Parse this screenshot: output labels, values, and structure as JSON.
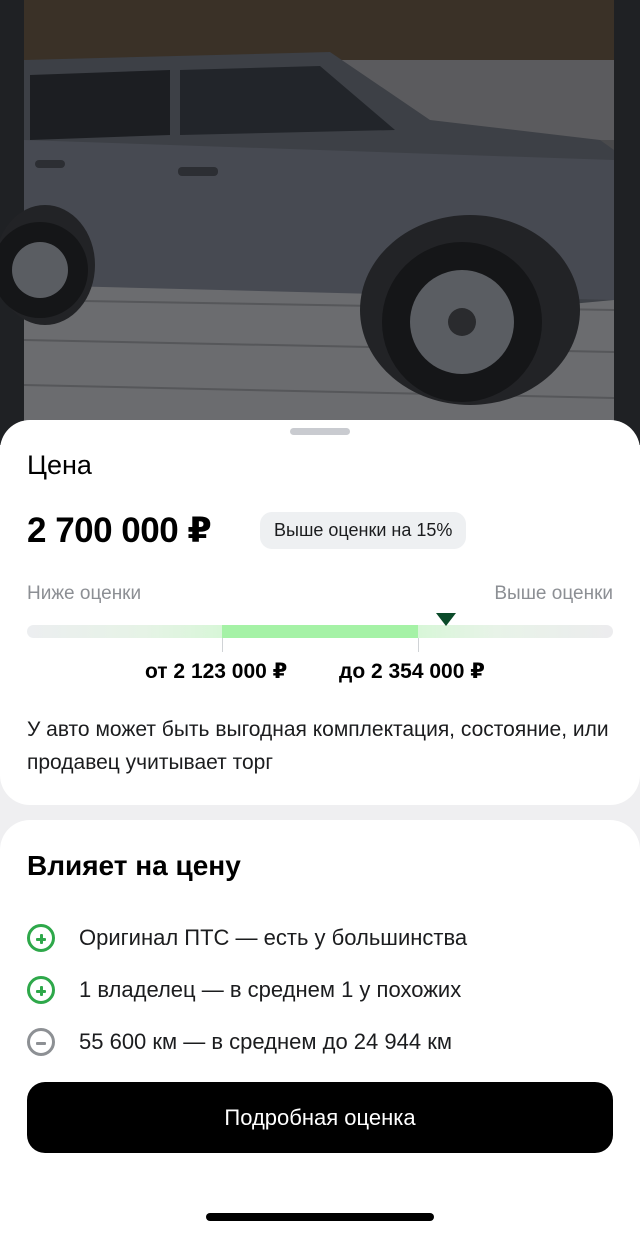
{
  "photo": {
    "alt_icon": "car-photo"
  },
  "price_sheet": {
    "title": "Цена",
    "price": "2 700 000 ₽",
    "badge": "Выше оценки на 15%",
    "scale": {
      "low_label": "Ниже оценки",
      "high_label": "Выше оценки",
      "range_from": "от 2 123 000 ₽",
      "range_to": "до 2 354 000 ₽"
    },
    "note": "У авто может быть выгодная комплектация, состояние, или продавец учитывает торг"
  },
  "factors": {
    "title": "Влияет на цену",
    "items": [
      {
        "icon": "plus-circle-icon",
        "text": "Оригинал ПТС — есть у большинства"
      },
      {
        "icon": "plus-circle-icon",
        "text": "1 владелец — в среднем 1 у похожих"
      },
      {
        "icon": "minus-circle-icon",
        "text": "55 600 км — в среднем до 24 944 км"
      }
    ],
    "button_label": "Подробная оценка"
  },
  "colors": {
    "positive": "#2ea84a",
    "neutral": "#8d9094",
    "range_fill": "#a5f2a6",
    "marker": "#0b4b2a"
  }
}
